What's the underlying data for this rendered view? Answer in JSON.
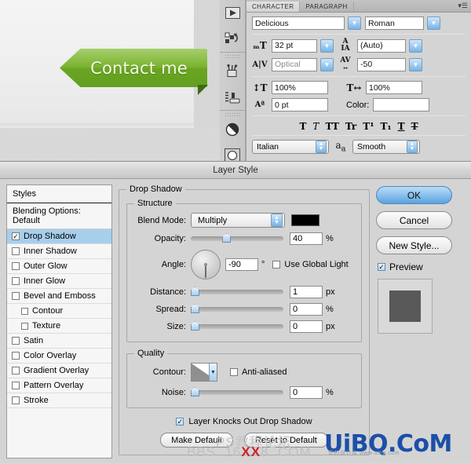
{
  "canvas": {
    "ribbon_label": "Contact me",
    "ribbon_color": "#79b32d",
    "ribbon_fold_color": "#3f6b13"
  },
  "dock": {
    "icons": [
      "play-arrow-icon",
      "swatch-rotate-icon",
      "brush-preset-icon",
      "tool-preset-icon",
      "half-circle-icon",
      "circle-button-icon"
    ]
  },
  "character_panel": {
    "tabs": [
      {
        "label": "CHARACTER",
        "active": true
      },
      {
        "label": "PARAGRAPH",
        "active": false
      }
    ],
    "menu_icon": "panel-menu-icon",
    "font_family": "Delicious",
    "font_style": "Roman",
    "font_size": "32 pt",
    "leading": "(Auto)",
    "kerning": "Optical",
    "tracking": "-50",
    "vertical_scale": "100%",
    "horizontal_scale": "100%",
    "baseline_shift": "0 pt",
    "color_label": "Color:",
    "color_value": "",
    "type_buttons": [
      "T",
      "T",
      "TT",
      "Tr",
      "T¹",
      "T₁",
      "T",
      "T"
    ],
    "language": "Italian",
    "anti_alias": "Smooth",
    "anti_alias_icon": "aa-icon",
    "icons": {
      "font_size": "font-size-icon",
      "leading": "leading-icon",
      "kerning": "kerning-icon",
      "tracking": "tracking-icon",
      "vscale": "vertical-scale-icon",
      "hscale": "horizontal-scale-icon",
      "baseline": "baseline-shift-icon"
    }
  },
  "dialog": {
    "title": "Layer Style",
    "styles_list": {
      "header": "Styles",
      "blending_options": "Blending Options: Default",
      "items": [
        {
          "label": "Drop Shadow",
          "checked": true,
          "selected": true,
          "indent": false
        },
        {
          "label": "Inner Shadow",
          "checked": false,
          "selected": false,
          "indent": false
        },
        {
          "label": "Outer Glow",
          "checked": false,
          "selected": false,
          "indent": false
        },
        {
          "label": "Inner Glow",
          "checked": false,
          "selected": false,
          "indent": false
        },
        {
          "label": "Bevel and Emboss",
          "checked": false,
          "selected": false,
          "indent": false
        },
        {
          "label": "Contour",
          "checked": false,
          "selected": false,
          "indent": true
        },
        {
          "label": "Texture",
          "checked": false,
          "selected": false,
          "indent": true
        },
        {
          "label": "Satin",
          "checked": false,
          "selected": false,
          "indent": false
        },
        {
          "label": "Color Overlay",
          "checked": false,
          "selected": false,
          "indent": false
        },
        {
          "label": "Gradient Overlay",
          "checked": false,
          "selected": false,
          "indent": false
        },
        {
          "label": "Pattern Overlay",
          "checked": false,
          "selected": false,
          "indent": false
        },
        {
          "label": "Stroke",
          "checked": false,
          "selected": false,
          "indent": false
        }
      ]
    },
    "section_title": "Drop Shadow",
    "structure": {
      "legend": "Structure",
      "blend_mode_label": "Blend Mode:",
      "blend_mode_value": "Multiply",
      "shadow_color": "#000000",
      "opacity_label": "Opacity:",
      "opacity_value": "40",
      "opacity_unit": "%",
      "angle_label": "Angle:",
      "angle_value": "-90",
      "angle_unit": "°",
      "use_global_light_label": "Use Global Light",
      "use_global_light_checked": false,
      "distance_label": "Distance:",
      "distance_value": "1",
      "distance_unit": "px",
      "spread_label": "Spread:",
      "spread_value": "0",
      "spread_unit": "%",
      "size_label": "Size:",
      "size_value": "0",
      "size_unit": "px"
    },
    "quality": {
      "legend": "Quality",
      "contour_label": "Contour:",
      "contour_icon": "contour-thumbnail",
      "anti_aliased_label": "Anti-aliased",
      "anti_aliased_checked": false,
      "noise_label": "Noise:",
      "noise_value": "0",
      "noise_unit": "%"
    },
    "knockout_label": "Layer Knocks Out Drop Shadow",
    "knockout_checked": true,
    "make_default": "Make Default",
    "reset_default": "Reset to Default",
    "buttons": {
      "ok": "OK",
      "cancel": "Cancel",
      "new_style": "New Style...",
      "preview_label": "Preview",
      "preview_checked": true
    }
  },
  "watermarks": {
    "blue": "UiBQ.CoM",
    "blue_sub": "您的设计库  www.uibq.com",
    "cn": "PS教程论坛",
    "bbs_pre": "BBS. 16",
    "bbs_hot": "XX",
    "bbs_post": "8. COM"
  }
}
